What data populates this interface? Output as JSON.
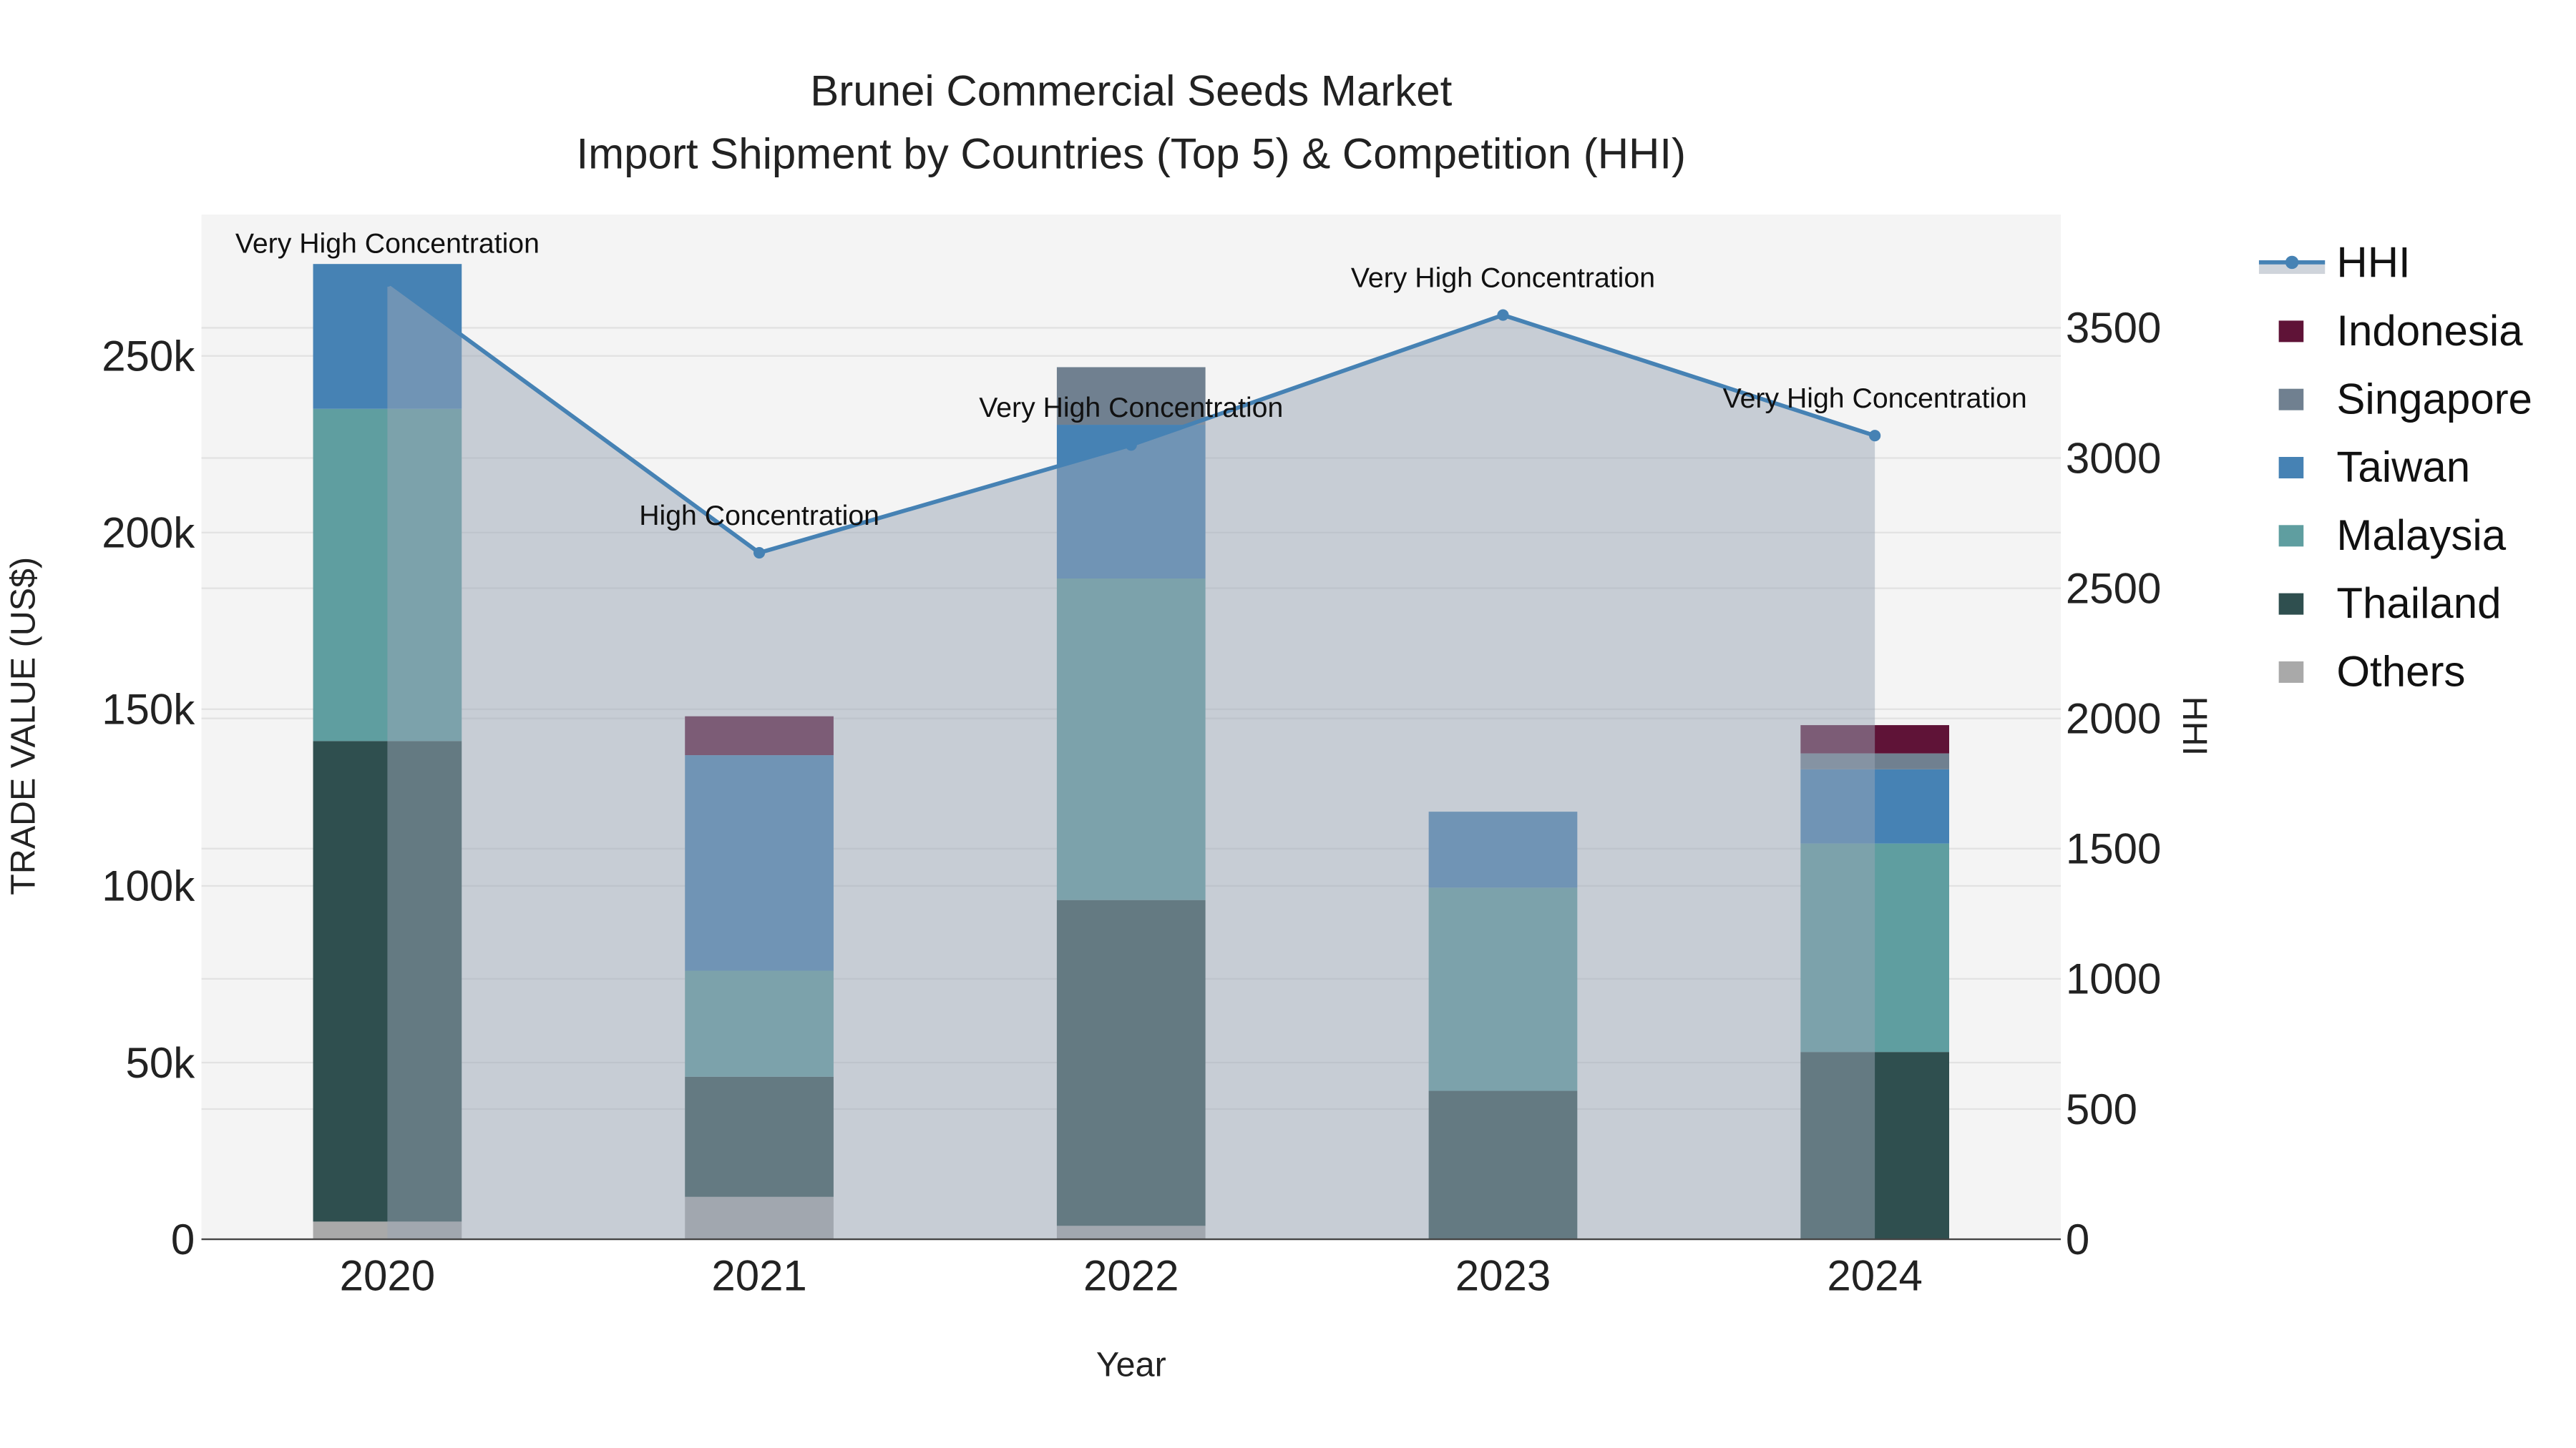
{
  "chart_data": {
    "type": "bar",
    "title": "Brunei Commercial Seeds Market",
    "subtitle": "Import Shipment by Countries (Top 5) & Competition (HHI)",
    "xlabel": "Year",
    "ylabel": "TRADE VALUE (US$)",
    "y2label": "HHI",
    "categories": [
      "2020",
      "2021",
      "2022",
      "2023",
      "2024"
    ],
    "ylim": [
      0,
      290000
    ],
    "y2lim": [
      0,
      3935
    ],
    "yticks": [
      0,
      50000,
      100000,
      150000,
      200000,
      250000
    ],
    "ytick_labels": [
      "0",
      "50k",
      "100k",
      "150k",
      "200k",
      "250k"
    ],
    "y2ticks": [
      0,
      500,
      1000,
      1500,
      2000,
      2500,
      3000,
      3500
    ],
    "y2tick_labels": [
      "0",
      "500",
      "1000",
      "1500",
      "2000",
      "2500",
      "3000",
      "3500"
    ],
    "stacked": true,
    "series": [
      {
        "name": "Others",
        "color": "#a9a9a9",
        "values": [
          5000,
          12000,
          3800,
          0,
          0
        ]
      },
      {
        "name": "Thailand",
        "color": "#2f4f4f",
        "values": [
          136000,
          34000,
          92200,
          42000,
          53000
        ]
      },
      {
        "name": "Malaysia",
        "color": "#5f9ea0",
        "values": [
          94000,
          30000,
          91000,
          57500,
          59000
        ]
      },
      {
        "name": "Taiwan",
        "color": "#4682b4",
        "values": [
          41000,
          61000,
          43500,
          21500,
          21000
        ]
      },
      {
        "name": "Singapore",
        "color": "#708090",
        "values": [
          0,
          0,
          16300,
          0,
          4500
        ]
      },
      {
        "name": "Indonesia",
        "color": "#5f1337",
        "values": [
          0,
          11000,
          0,
          0,
          8000
        ]
      }
    ],
    "hhi": {
      "name": "HHI",
      "color": "#4682b4",
      "values": [
        3680,
        2636,
        3050,
        3549,
        3086
      ],
      "annotations": [
        "Very High Concentration",
        "High Concentration",
        "Very High Concentration",
        "Very High Concentration",
        "Very High Concentration"
      ]
    },
    "legend_order": [
      "HHI",
      "Indonesia",
      "Singapore",
      "Taiwan",
      "Malaysia",
      "Thailand",
      "Others"
    ],
    "legend_position": "right",
    "grid": true
  }
}
